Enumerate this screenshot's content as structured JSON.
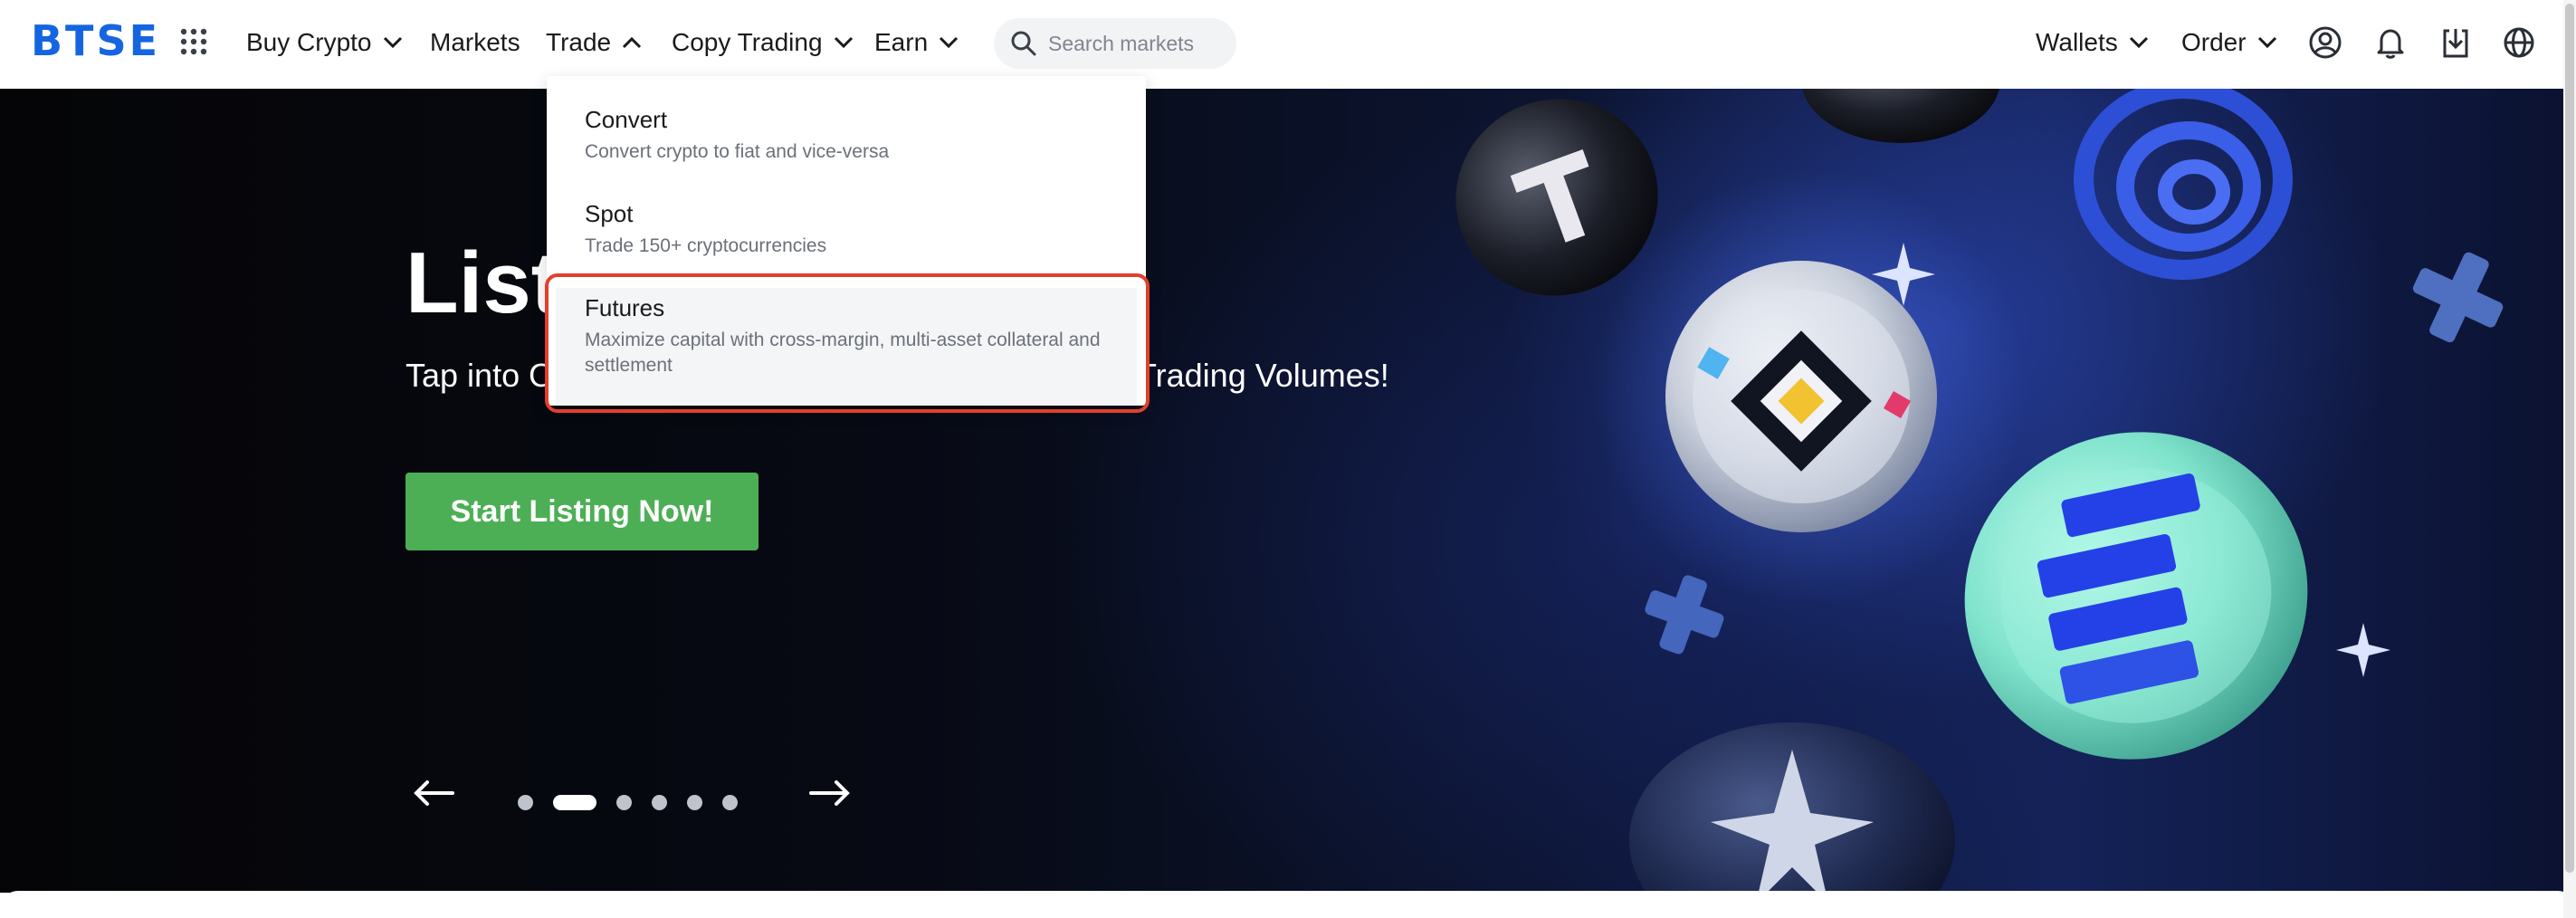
{
  "brand": {
    "logo_text": "BTSE",
    "logo_color": "#1565e0"
  },
  "nav": {
    "buy_crypto": "Buy Crypto",
    "markets": "Markets",
    "trade": "Trade",
    "copy_trading": "Copy Trading",
    "earn": "Earn"
  },
  "search": {
    "placeholder": "Search markets"
  },
  "header_right": {
    "wallets": "Wallets",
    "order": "Order"
  },
  "icons": [
    "apps-grid-icon",
    "chevron-down-icon",
    "chevron-up-icon",
    "search-icon",
    "user-icon",
    "bell-icon",
    "download-icon",
    "globe-icon",
    "arrow-left-icon",
    "arrow-right-icon"
  ],
  "trade_menu": {
    "items": [
      {
        "title": "Convert",
        "description": "Convert crypto to fiat and vice-versa"
      },
      {
        "title": "Spot",
        "description": "Trade 150+ cryptocurrencies"
      },
      {
        "title": "Futures",
        "description": "Maximize capital with cross-margin, multi-asset collateral and settlement"
      }
    ],
    "highlight_color": "#e2402c"
  },
  "hero": {
    "title": "List",
    "subtitle_left": "Tap into Ou",
    "subtitle_right": "Trading Volumes!",
    "cta_label": "Start Listing Now!",
    "cta_color": "#4caf55"
  },
  "carousel": {
    "slide_count": 6,
    "active_index": 1
  }
}
